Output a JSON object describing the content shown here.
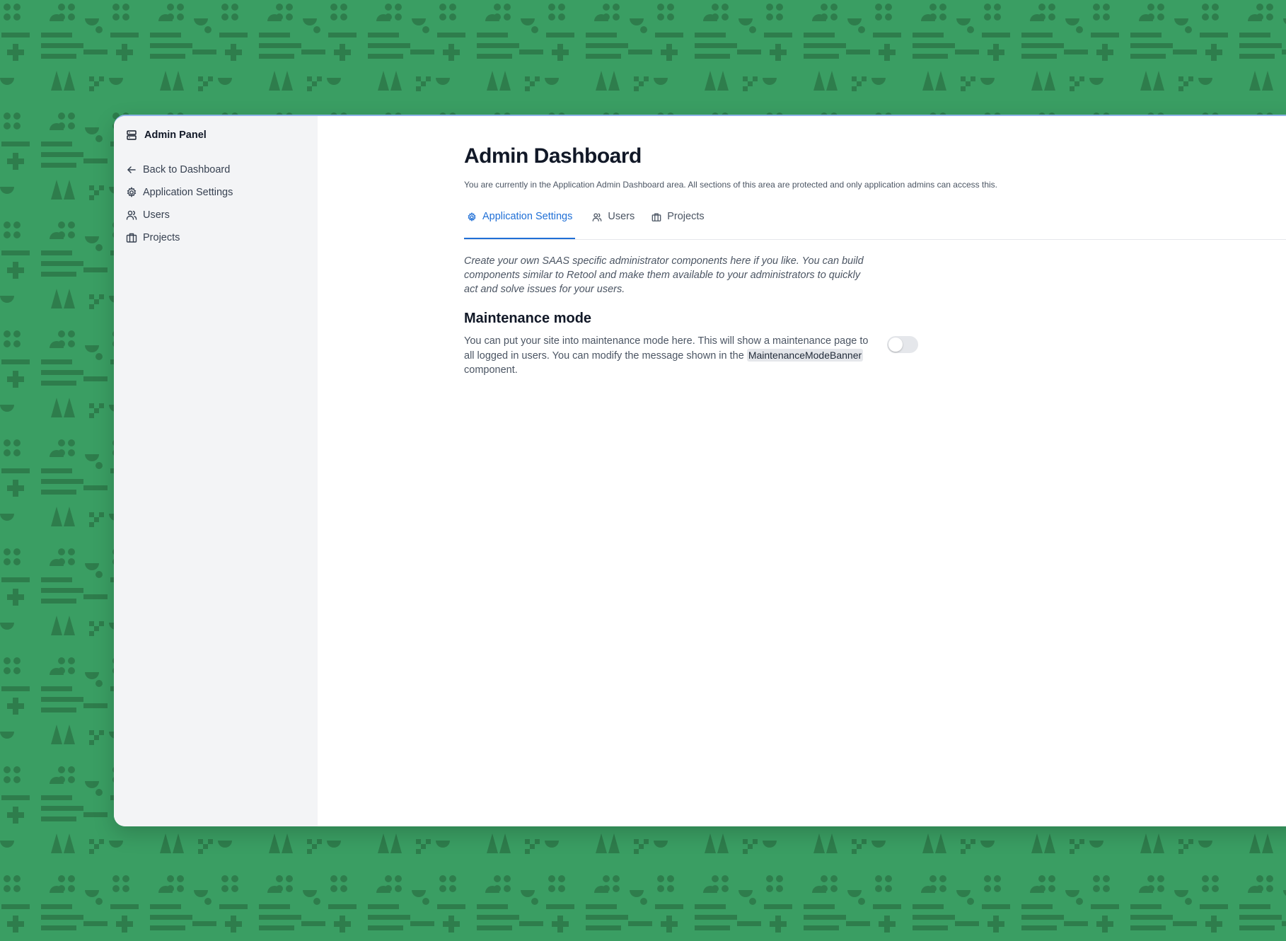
{
  "colors": {
    "background": "#3a9e63",
    "pattern": "#2e7d4c",
    "accent": "#1f6fd6",
    "sidebar_bg": "#f3f4f6"
  },
  "sidebar": {
    "brand": {
      "icon": "server-icon",
      "label": "Admin Panel"
    },
    "items": [
      {
        "icon": "arrow-left-icon",
        "label": "Back to Dashboard"
      },
      {
        "icon": "gear-icon",
        "label": "Application Settings"
      },
      {
        "icon": "users-icon",
        "label": "Users"
      },
      {
        "icon": "briefcase-icon",
        "label": "Projects"
      }
    ]
  },
  "main": {
    "title": "Admin Dashboard",
    "subtitle": "You are currently in the Application Admin Dashboard area. All sections of this area are protected and only application admins can access this.",
    "tabs": [
      {
        "icon": "gear-icon",
        "label": "Application Settings",
        "active": true
      },
      {
        "icon": "users-icon",
        "label": "Users",
        "active": false
      },
      {
        "icon": "briefcase-icon",
        "label": "Projects",
        "active": false
      }
    ],
    "intro": "Create your own SAAS specific administrator components here if you like. You can build components similar to Retool and make them available to your administrators to quickly act and solve issues for your users.",
    "maintenance": {
      "title": "Maintenance mode",
      "desc_before": "You can put your site into maintenance mode here. This will show a maintenance page to all logged in users. You can modify the message shown in the ",
      "code": "MaintenanceModeBanner",
      "desc_after": " component.",
      "enabled": false
    }
  }
}
